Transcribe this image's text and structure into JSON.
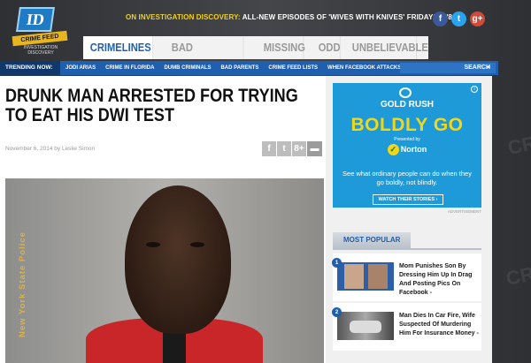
{
  "site": {
    "logo_badge": "ID",
    "logo_banner": "CRIME FEED",
    "logo_sub": "INVESTIGATION DISCOVERY",
    "promo_highlight": "ON INVESTIGATION DISCOVERY:",
    "promo_text": " ALL-NEW EPISODES OF 'WIVES WITH KNIVES' FRIDAYS, 9/8C"
  },
  "social": [
    {
      "icon": "facebook-icon",
      "glyph": "f",
      "color": "#3b5998"
    },
    {
      "icon": "twitter-icon",
      "glyph": "t",
      "color": "#2aa3ef"
    },
    {
      "icon": "google-plus-icon",
      "glyph": "g+",
      "color": "#d34836"
    }
  ],
  "nav": {
    "items": [
      "CRIMELINES",
      "BAD BEHAVIOR",
      "MISSING",
      "ODD",
      "UNBELIEVABLE"
    ]
  },
  "trending": {
    "label": "TRENDING NOW:",
    "items": [
      "JODI ARIAS",
      "CRIME IN FLORIDA",
      "DUMB CRIMINALS",
      "BAD PARENTS",
      "CRIME FEED LISTS",
      "WHEN FACEBOOK ATTACKS"
    ],
    "search_label": "SEARCH"
  },
  "article": {
    "headline": "DRUNK MAN ARRESTED FOR TRYING TO EAT HIS DWI TEST",
    "dateline": "November 6, 2014 by Leslie Simon",
    "photo_watermark": "New York State Police"
  },
  "share": [
    {
      "icon": "facebook-icon",
      "glyph": "f"
    },
    {
      "icon": "twitter-icon",
      "glyph": "t"
    },
    {
      "icon": "google-plus-icon",
      "glyph": "8+"
    },
    {
      "icon": "comment-icon",
      "glyph": "▬"
    }
  ],
  "ad": {
    "title": "GOLD RUSH",
    "headline": "BOLDLY GO",
    "presented": "Presented by",
    "sponsor": "Norton",
    "copy": "See what ordinary people can do when they go boldly, not blindly.",
    "cta": "WATCH THEIR STORIES ›",
    "label": "ADVERTISEMENT"
  },
  "most_popular": {
    "tab": "MOST POPULAR",
    "items": [
      {
        "num": "1",
        "title": "Mom Punishes Son By Dressing Him Up In Drag And Posting Pics On Facebook -"
      },
      {
        "num": "2",
        "title": "Man Dies In Car Fire, Wife Suspected Of Murdering Him For Insurance Money -"
      }
    ]
  },
  "colors": {
    "brand_blue": "#1f5fae",
    "promo_yellow": "#f0d020",
    "ad_blue": "#1f9ad8"
  }
}
